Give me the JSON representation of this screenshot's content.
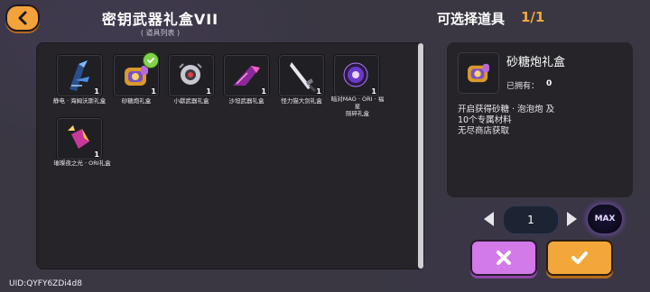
{
  "header": {
    "title": "密钥武器礼盒VII",
    "subtitle": "( 道具列表 )",
    "select_label": "可选择道具",
    "select_count": "1/1"
  },
  "items": [
    {
      "label": "静电 · 海姆沃斯礼盒",
      "qty": "1",
      "icon": "static-weapon-icon",
      "selected": false
    },
    {
      "label": "砂糖炮礼盒",
      "qty": "1",
      "icon": "sugar-cannon-icon",
      "selected": true
    },
    {
      "label": "小獻武器礼盒",
      "qty": "1",
      "icon": "small-robot-weapon-icon",
      "selected": false
    },
    {
      "label": "沙坦武器礼盒",
      "qty": "1",
      "icon": "satan-weapon-icon",
      "selected": false
    },
    {
      "label": "怪力猫大剑礼盒",
      "qty": "1",
      "icon": "cat-greatsword-icon",
      "selected": false
    },
    {
      "label": "暗对MAO · ORI · 福星\n陨碎礼盒",
      "qty": "1",
      "icon": "void-orb-icon",
      "selected": false
    },
    {
      "label": "璀璨夜之光 · ORI礼盒",
      "qty": "1",
      "icon": "night-light-crystal-icon",
      "selected": false
    }
  ],
  "detail": {
    "name": "砂糖炮礼盒",
    "owned_label": "已拥有：",
    "owned_value": "0",
    "description": "开启获得砂糖 · 泡泡炮 及\n10个专属材料\n无尽商店获取"
  },
  "quantity": {
    "value": "1",
    "max_label": "MAX"
  },
  "footer": {
    "uid": "UID:QYFY6ZDi4d8"
  },
  "colors": {
    "accent_orange": "#f3a73a",
    "cancel_purple": "#d17ae8",
    "selected_green": "#7ed44a"
  }
}
